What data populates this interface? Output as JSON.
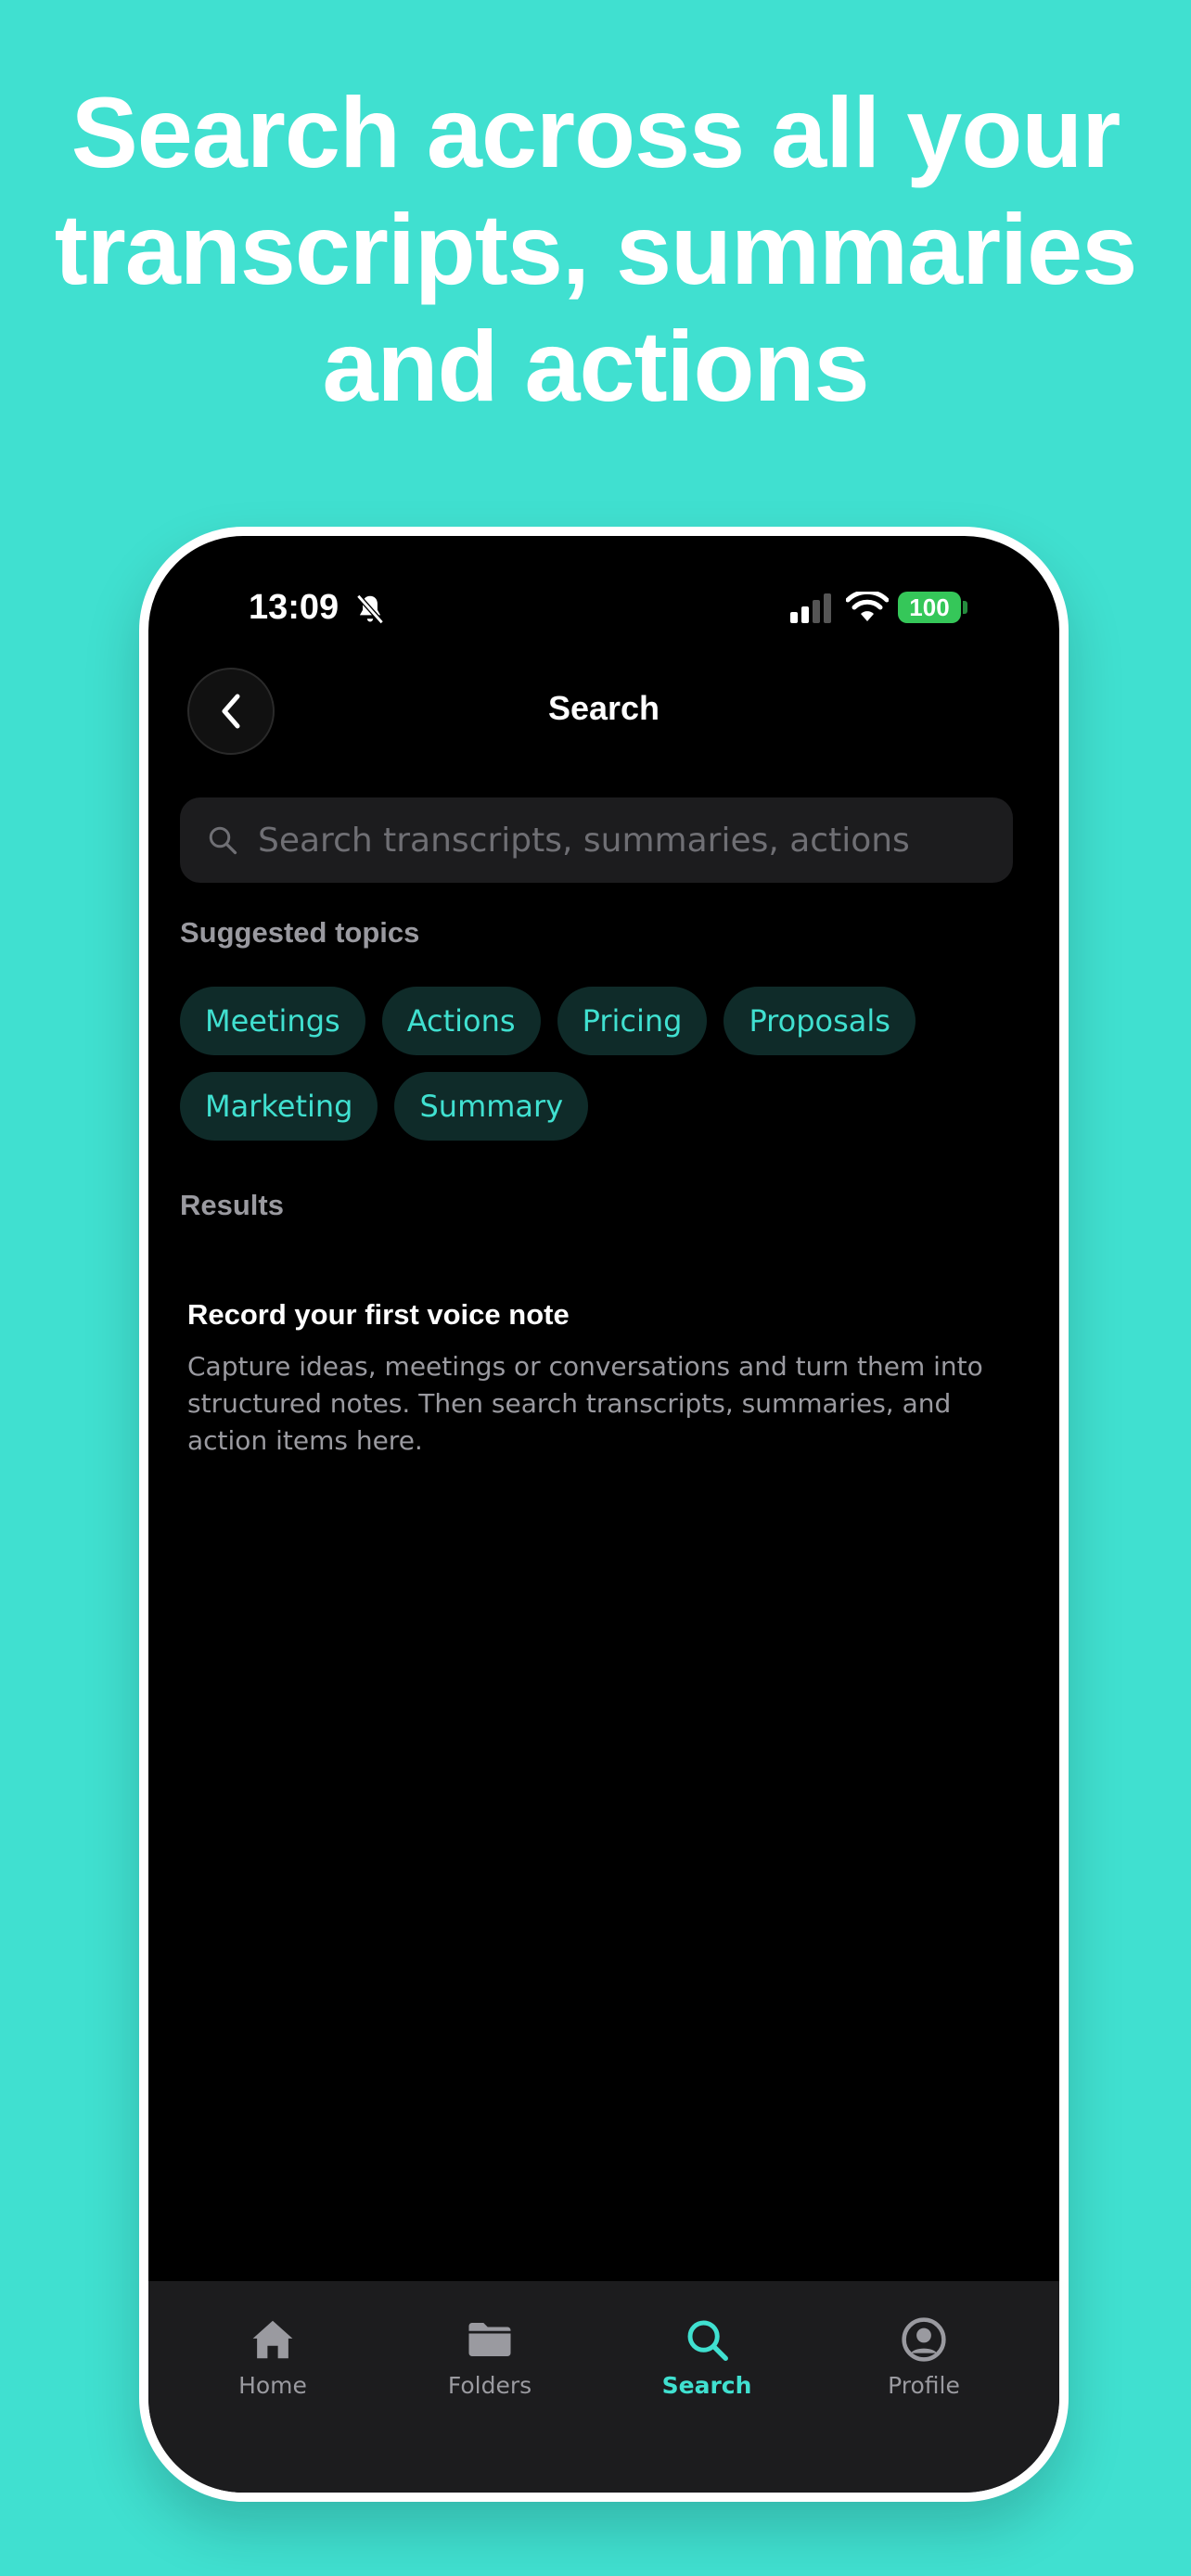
{
  "headline": {
    "lines": [
      "Search across all your",
      "transcripts, summaries",
      "and actions"
    ]
  },
  "status_bar": {
    "time": "13:09",
    "battery": "100"
  },
  "header": {
    "title": "Search"
  },
  "search": {
    "placeholder": "Search transcripts, summaries, actions",
    "value": ""
  },
  "suggested": {
    "label": "Suggested topics",
    "chips": [
      "Meetings",
      "Actions",
      "Pricing",
      "Proposals",
      "Marketing",
      "Summary"
    ]
  },
  "results": {
    "label": "Results",
    "empty_title": "Record your first voice note",
    "empty_body": "Capture ideas, meetings or conversations and turn them into structured notes. Then search transcripts, summaries, and action items here."
  },
  "tabbar": {
    "tabs": [
      {
        "label": "Home",
        "icon": "home-icon"
      },
      {
        "label": "Folders",
        "icon": "folder-icon"
      },
      {
        "label": "Search",
        "icon": "search-icon",
        "active": true
      },
      {
        "label": "Profile",
        "icon": "profile-icon"
      }
    ]
  },
  "colors": {
    "accent": "#40E0D0",
    "background": "#000000",
    "chip_bg": "#0F2B29",
    "surface": "#1C1C1E",
    "battery": "#35C759"
  }
}
